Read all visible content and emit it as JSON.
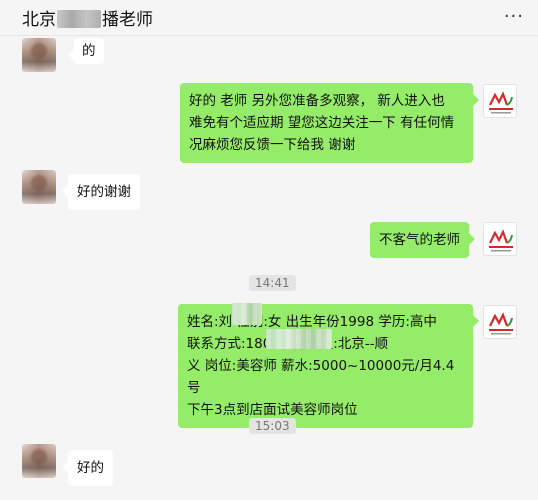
{
  "header": {
    "title_prefix": "北京",
    "title_suffix": "播老师",
    "more_label": "···"
  },
  "messages": [
    {
      "side": "left",
      "text": "的"
    },
    {
      "side": "right",
      "text_lines": [
        "好的 老师 另外您准备多观察， 新人进入也",
        "难免有个适应期 望您这边关注一下 有任何情",
        "况麻烦您反馈一下给我 谢谢"
      ]
    },
    {
      "side": "left",
      "text": "好的谢谢"
    },
    {
      "side": "right",
      "text": "不客气的老师"
    },
    {
      "time": "14:41"
    },
    {
      "side": "right",
      "text_lines": [
        "姓名:刘  性别:女 出生年份1998 学历:高中",
        " 联系方式:18032        作地点:北京--顺",
        "义 岗位:美容师 薪水:5000~10000元/月4.4号",
        "下午3点到店面试美容师岗位"
      ]
    },
    {
      "time": "15:03"
    },
    {
      "side": "left",
      "text": "好的"
    }
  ],
  "colors": {
    "right_bubble": "#95ec69",
    "left_bubble": "#ffffff",
    "background": "#f5f5f5"
  }
}
